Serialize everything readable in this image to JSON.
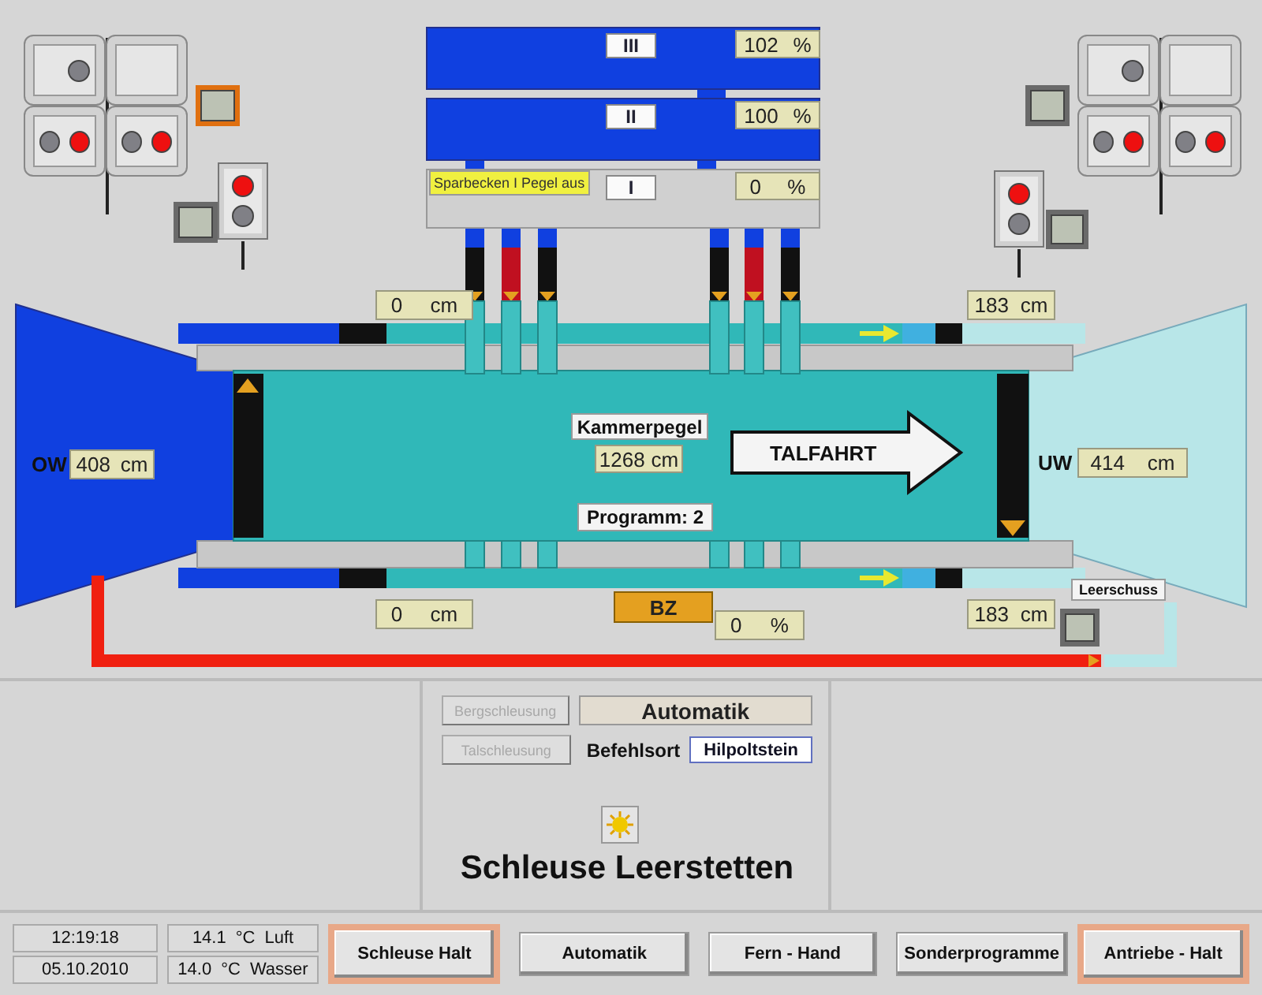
{
  "reservoirs": [
    {
      "label": "III",
      "value": "102",
      "unit": "%"
    },
    {
      "label": "II",
      "value": "100",
      "unit": "%"
    },
    {
      "label": "I",
      "value": "0",
      "unit": "%",
      "status": "Sparbecken I Pegel aus"
    }
  ],
  "gauges": [
    {
      "value": "0",
      "unit": "cm"
    },
    {
      "value": "183",
      "unit": "cm"
    },
    {
      "value": "0",
      "unit": "cm"
    },
    {
      "value": "183",
      "unit": "cm"
    }
  ],
  "upper_water": {
    "label": "OW",
    "value": "408",
    "unit": "cm"
  },
  "lower_water": {
    "label": "UW",
    "value": "414",
    "unit": "cm"
  },
  "chamber": {
    "label": "Kammerpegel",
    "value": "1268",
    "unit": "cm",
    "direction": "TALFAHRT",
    "program": "Programm: 2"
  },
  "bz": {
    "label": "BZ",
    "value": "0",
    "unit": "%"
  },
  "leerschuss": {
    "label": "Leerschuss"
  },
  "signals": [
    {
      "heads": [
        {
          "kind": "lamps",
          "lamps": [
            {
              "on": false
            }
          ]
        },
        {
          "kind": "blank"
        },
        {
          "kind": "lamps",
          "lamps": [
            {
              "on": false
            },
            {
              "on": true
            }
          ]
        },
        {
          "kind": "lamps",
          "lamps": [
            {
              "on": false
            },
            {
              "on": true
            }
          ]
        }
      ]
    },
    {
      "heads": [
        {
          "kind": "lamps",
          "lamps": [
            {
              "on": false
            }
          ]
        },
        {
          "kind": "blank"
        },
        {
          "kind": "lamps",
          "lamps": [
            {
              "on": false
            },
            {
              "on": true
            }
          ]
        },
        {
          "kind": "lamps",
          "lamps": [
            {
              "on": false
            },
            {
              "on": true
            }
          ]
        }
      ]
    }
  ],
  "small_signals": [
    {
      "lamps": [
        {
          "on": true
        },
        {
          "on": false
        }
      ]
    },
    {
      "lamps": [
        {
          "on": true
        },
        {
          "on": false
        }
      ]
    }
  ],
  "indicators": [
    {
      "active": true
    },
    {
      "active": false
    },
    {
      "active": false
    },
    {
      "active": false
    },
    {
      "active": false
    }
  ],
  "control": {
    "buttons": [
      {
        "label": "Bergschleusung",
        "disabled": true
      },
      {
        "label": "Talschleusung",
        "disabled": true
      }
    ],
    "mode": "Automatik",
    "command_label": "Befehlsort",
    "command_place": "Hilpoltstein",
    "title": "Schleuse Leerstetten"
  },
  "status": {
    "time": "12:19:18",
    "date": "05.10.2010",
    "temperatures": [
      {
        "value": "14.1",
        "unit": "°C",
        "label": "Luft"
      },
      {
        "value": "14.0",
        "unit": "°C",
        "label": "Wasser"
      }
    ]
  },
  "buttons": [
    {
      "label": "Schleuse Halt",
      "alarm": true
    },
    {
      "label": "Automatik",
      "alarm": false
    },
    {
      "label": "Fern - Hand",
      "alarm": false
    },
    {
      "label": "Sonderprogramme",
      "alarm": false
    },
    {
      "label": "Antriebe - Halt",
      "alarm": true
    }
  ]
}
